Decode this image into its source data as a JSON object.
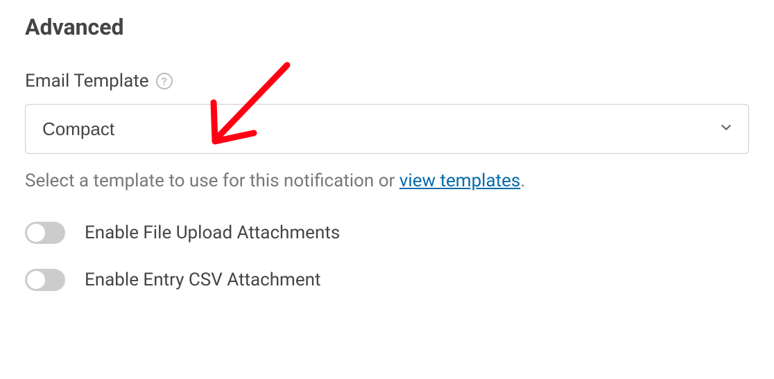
{
  "section": {
    "heading": "Advanced"
  },
  "email_template": {
    "label": "Email Template",
    "help_glyph": "?",
    "selected": "Compact",
    "helper_prefix": "Select a template to use for this notification or ",
    "helper_link": "view templates",
    "helper_suffix": "."
  },
  "toggles": {
    "file_upload": {
      "label": "Enable File Upload Attachments",
      "enabled": false
    },
    "entry_csv": {
      "label": "Enable Entry CSV Attachment",
      "enabled": false
    }
  }
}
